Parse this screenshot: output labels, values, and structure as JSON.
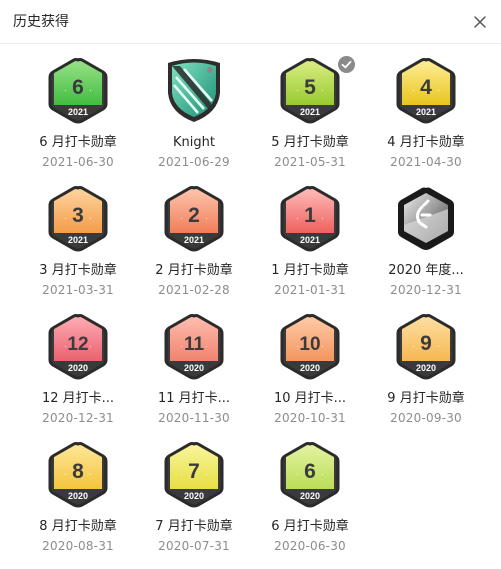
{
  "dialog": {
    "title": "历史获得"
  },
  "badges": [
    {
      "type": "hex",
      "num": "6",
      "year": "2021",
      "name": "6 月打卡勋章",
      "date": "2021-06-30",
      "top": "#9fe58e",
      "bottom": "#3dbb3d",
      "band": "#3a3a3a"
    },
    {
      "type": "knight",
      "name": "Knight",
      "date": "2021-06-29"
    },
    {
      "type": "hex",
      "num": "5",
      "year": "2021",
      "name": "5 月打卡勋章",
      "date": "2021-05-31",
      "top": "#dff08a",
      "bottom": "#95c92b",
      "band": "#3a3a3a",
      "checked": true
    },
    {
      "type": "hex",
      "num": "4",
      "year": "2021",
      "name": "4 月打卡勋章",
      "date": "2021-04-30",
      "top": "#fff0a0",
      "bottom": "#e8c317",
      "band": "#3a3a3a"
    },
    {
      "type": "hex",
      "num": "3",
      "year": "2021",
      "name": "3 月打卡勋章",
      "date": "2021-03-31",
      "top": "#ffd8a6",
      "bottom": "#f39a45",
      "band": "#3a3a3a"
    },
    {
      "type": "hex",
      "num": "2",
      "year": "2021",
      "name": "2 月打卡勋章",
      "date": "2021-02-28",
      "top": "#ffcbb5",
      "bottom": "#f07a55",
      "band": "#3a3a3a"
    },
    {
      "type": "hex",
      "num": "1",
      "year": "2021",
      "name": "1 月打卡勋章",
      "date": "2021-01-31",
      "top": "#ffc3bf",
      "bottom": "#ee5d5a",
      "band": "#3a3a3a"
    },
    {
      "type": "annual",
      "name": "2020 年度...",
      "date": "2020-12-31"
    },
    {
      "type": "hex",
      "num": "12",
      "year": "2020",
      "name": "12 月打卡...",
      "date": "2020-12-31",
      "top": "#ffb3b9",
      "bottom": "#ea5d6c",
      "band": "#3a3a3a"
    },
    {
      "type": "hex",
      "num": "11",
      "year": "2020",
      "name": "11 月打卡...",
      "date": "2020-11-30",
      "top": "#ffc2b6",
      "bottom": "#f0806b",
      "band": "#3a3a3a"
    },
    {
      "type": "hex",
      "num": "10",
      "year": "2020",
      "name": "10 月打卡...",
      "date": "2020-10-31",
      "top": "#ffcfae",
      "bottom": "#f3935a",
      "band": "#3a3a3a"
    },
    {
      "type": "hex",
      "num": "9",
      "year": "2020",
      "name": "9 月打卡勋章",
      "date": "2020-09-30",
      "top": "#ffe2a8",
      "bottom": "#f5b64f",
      "band": "#3a3a3a"
    },
    {
      "type": "hex",
      "num": "8",
      "year": "2020",
      "name": "8 月打卡勋章",
      "date": "2020-08-31",
      "top": "#ffeaa0",
      "bottom": "#f3c339",
      "band": "#3a3a3a"
    },
    {
      "type": "hex",
      "num": "7",
      "year": "2020",
      "name": "7 月打卡勋章",
      "date": "2020-07-31",
      "top": "#fbf7a3",
      "bottom": "#e6de40",
      "band": "#3a3a3a"
    },
    {
      "type": "hex",
      "num": "6",
      "year": "2020",
      "name": "6 月打卡勋章",
      "date": "2020-06-30",
      "top": "#e6f5a8",
      "bottom": "#b9dc55",
      "band": "#3a3a3a"
    }
  ]
}
